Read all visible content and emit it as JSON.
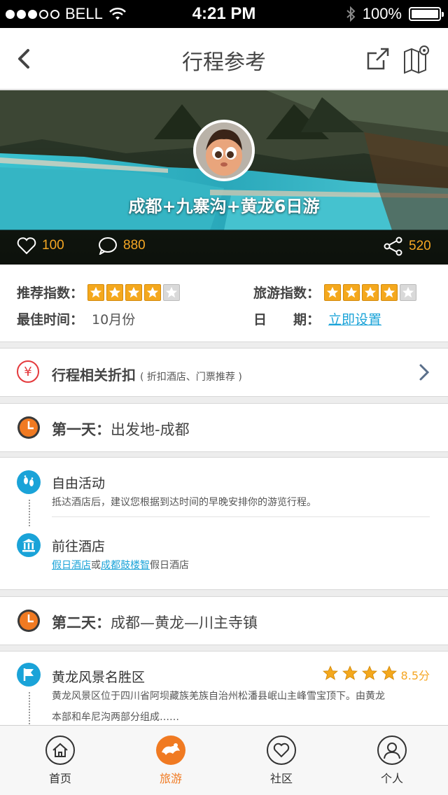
{
  "status_bar": {
    "carrier": "BELL",
    "time": "4:21 PM",
    "battery": "100%"
  },
  "navbar": {
    "title": "行程参考"
  },
  "hero": {
    "title": "成都+九寨沟+黄龙6日游",
    "likes": "100",
    "comments": "880",
    "shares": "520"
  },
  "info": {
    "recommend_label": "推荐指数：",
    "recommend_stars": 4,
    "travel_label": "旅游指数：",
    "travel_stars": 4,
    "best_time_label": "最佳时间：",
    "best_time_value": "10月份",
    "date_label": "日　　期：",
    "date_link": "立即设置"
  },
  "discount": {
    "icon": "yen-icon",
    "title": "行程相关折扣",
    "subtitle": "( 折扣酒店、门票推荐 )"
  },
  "day1": {
    "label": "第一天：",
    "route": "出发地-成都",
    "activities": [
      {
        "icon": "footprint-icon",
        "title": "自由活动",
        "desc": "抵达酒店后，建议您根据到达时间的早晚安排你的游览行程。"
      },
      {
        "icon": "hotel-icon",
        "title": "前往酒店",
        "link1": "假日酒店",
        "or": "或",
        "link2": "成都鼓楼智",
        "suffix": "假日酒店"
      }
    ]
  },
  "day2": {
    "label": "第二天：",
    "route": "成都—黄龙—川主寺镇",
    "activities": [
      {
        "icon": "flag-icon",
        "title": "黄龙风景名胜区",
        "rating_stars": 4,
        "score": "8.5分",
        "desc_line1": "黄龙风景区位于四川省阿坝藏族羌族自治州松潘县岷山主峰雪宝顶下。由黄龙",
        "desc_line2": "本部和牟尼沟两部分组成……"
      }
    ]
  },
  "tabbar": {
    "tabs": [
      {
        "label": "首页",
        "icon": "home-icon",
        "active": false
      },
      {
        "label": "旅游",
        "icon": "travel-icon",
        "active": true
      },
      {
        "label": "社区",
        "icon": "heart-icon",
        "active": false
      },
      {
        "label": "个人",
        "icon": "user-icon",
        "active": false
      }
    ]
  },
  "colors": {
    "accent": "#f07a22",
    "link": "#1aa3d8",
    "star": "#f4a81d",
    "discount": "#e4393c"
  }
}
